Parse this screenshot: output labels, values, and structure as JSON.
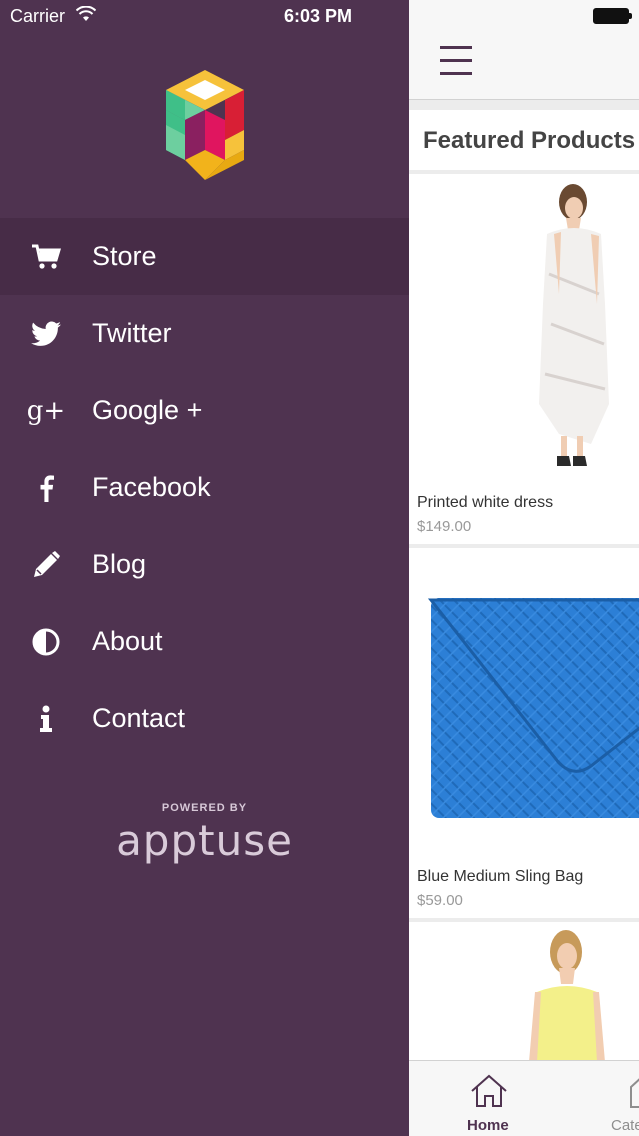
{
  "status_bar": {
    "carrier": "Carrier",
    "time": "6:03 PM"
  },
  "drawer": {
    "menu": [
      {
        "label": "Store",
        "icon": "cart-icon"
      },
      {
        "label": "Twitter",
        "icon": "twitter-icon"
      },
      {
        "label": "Google +",
        "icon": "google-plus-icon"
      },
      {
        "label": "Facebook",
        "icon": "facebook-icon"
      },
      {
        "label": "Blog",
        "icon": "pencil-icon"
      },
      {
        "label": "About",
        "icon": "half-circle-icon"
      },
      {
        "label": "Contact",
        "icon": "info-icon"
      }
    ],
    "powered_by": "POWERED BY",
    "brand": "apptuse"
  },
  "main": {
    "section_title": "Featured Products",
    "products": [
      {
        "name": "Printed white dress",
        "price": "$149.00"
      },
      {
        "name": "Blue Medium Sling Bag",
        "price": "$59.00"
      }
    ],
    "tabs": [
      {
        "label": "Home",
        "icon": "home-icon"
      },
      {
        "label": "Cate",
        "icon": "category-icon"
      }
    ]
  },
  "colors": {
    "drawer_bg": "#4f3350",
    "active_item_bg": "#472c47",
    "accent": "#4f3350"
  }
}
